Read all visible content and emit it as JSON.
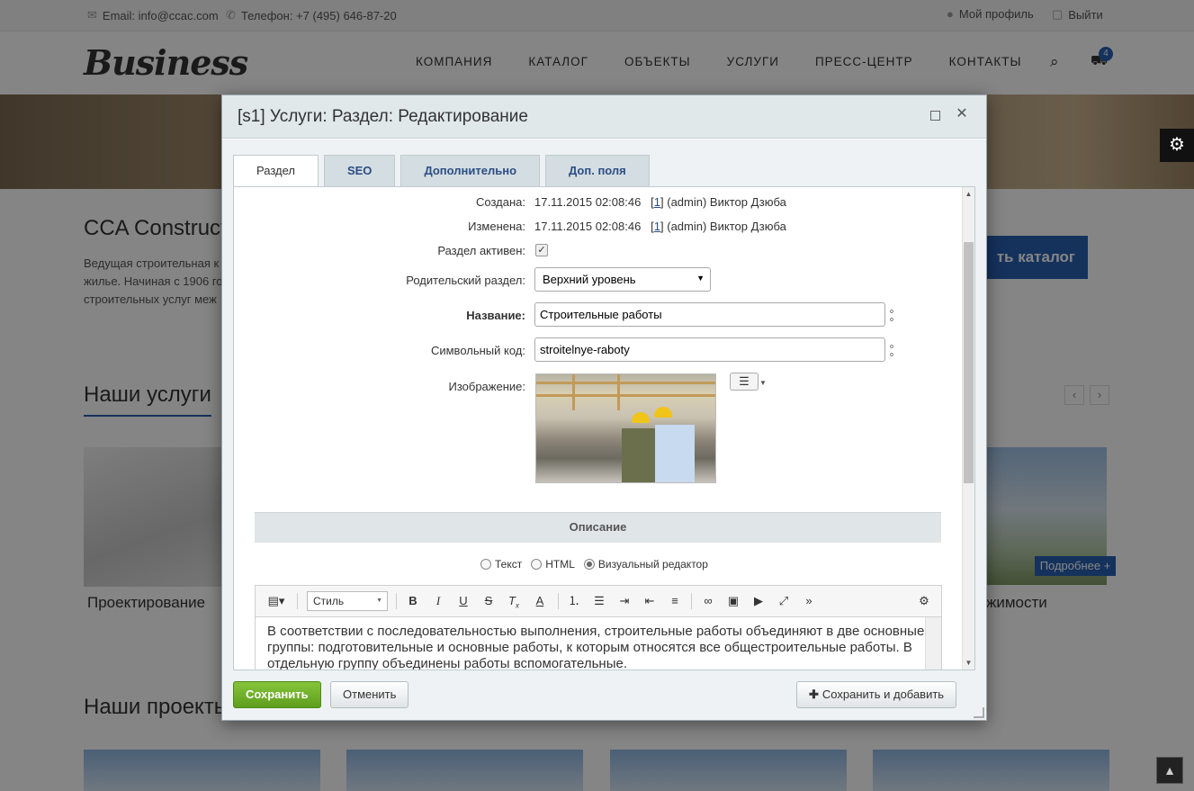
{
  "site": {
    "email_label": "Email: info@ccac.com",
    "phone_label": "Телефон: +7 (495) 646-87-20",
    "profile_label": "Мой профиль",
    "logout_label": "Выйти",
    "logo": "Business",
    "nav": [
      "КОМПАНИЯ",
      "КАТАЛОГ",
      "ОБЪЕКТЫ",
      "УСЛУГИ",
      "ПРЕСС-ЦЕНТР",
      "КОНТАКТЫ"
    ],
    "cart_count": "4",
    "cca_title": "CCA Construct",
    "cca_text": [
      "Ведущая строительная к",
      "жилье. Начиная с 1906 го",
      "строительных услуг меж"
    ],
    "catalog_button": "ть каталог",
    "services_title": "Наши услуги",
    "service_left_caption": "Проектирование",
    "service_right_caption": "жимости",
    "more_badge": "Подробнее +",
    "projects_title": "Наши проекть"
  },
  "dialog": {
    "title": "[s1] Услуги: Раздел: Редактирование",
    "tabs": [
      {
        "label": "Раздел",
        "active": true
      },
      {
        "label": "SEO",
        "active": false
      },
      {
        "label": "Дополнительно",
        "active": false
      },
      {
        "label": "Доп. поля",
        "active": false
      }
    ],
    "fields": {
      "created_label": "Создана:",
      "created_date": "17.11.2015 02:08:46",
      "created_user_link": "1",
      "created_user": "(admin) Виктор Дзюба",
      "modified_label": "Изменена:",
      "modified_date": "17.11.2015 02:08:46",
      "modified_user_link": "1",
      "modified_user": "(admin) Виктор Дзюба",
      "active_label": "Раздел активен:",
      "active_checked": true,
      "parent_label": "Родительский раздел:",
      "parent_value": "Верхний уровень",
      "name_label": "Название:",
      "name_value": "Строительные работы",
      "code_label": "Символьный код:",
      "code_value": "stroitelnye-raboty",
      "image_label": "Изображение:"
    },
    "description": {
      "header": "Описание",
      "modes": [
        {
          "label": "Текст",
          "selected": false
        },
        {
          "label": "HTML",
          "selected": false
        },
        {
          "label": "Визуальный редактор",
          "selected": true
        }
      ],
      "style_label": "Стиль",
      "toolbar_icons": [
        "source-icon",
        "bold-icon",
        "italic-icon",
        "underline-icon",
        "strikethrough-icon",
        "remove-format-icon",
        "font-color-icon",
        "ordered-list-icon",
        "unordered-list-icon",
        "indent-icon",
        "outdent-icon",
        "align-icon",
        "link-icon",
        "image-icon",
        "video-icon",
        "fullscreen-icon",
        "more-icon",
        "settings-icon"
      ],
      "text": "В соответствии с последовательностью выполнения, строительные работы объединяют в две основные группы: подготовительные и основные работы, к которым относятся все общестроительные работы. В отдельную группу объединены работы вспомогательные."
    },
    "buttons": {
      "save": "Сохранить",
      "cancel": "Отменить",
      "save_add": "Сохранить и добавить"
    }
  }
}
